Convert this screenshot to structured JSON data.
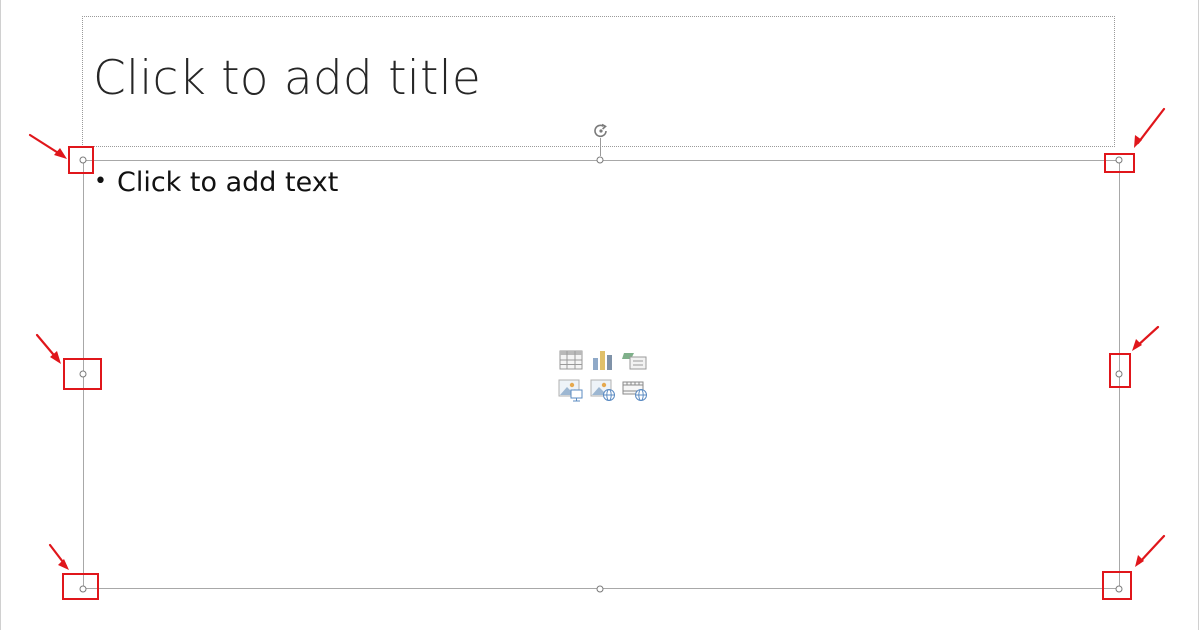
{
  "slide": {
    "title_placeholder": "Click to add title",
    "content_placeholder": {
      "bullet": "•",
      "text": "Click to add text"
    }
  },
  "content_insert_icons": [
    "insert-table-icon",
    "insert-chart-icon",
    "insert-smartart-icon",
    "insert-picture-icon",
    "insert-online-picture-icon",
    "insert-video-icon"
  ],
  "annotation_color": "#e0161b",
  "selection_handles": [
    "top-left",
    "top-center",
    "top-right",
    "middle-left",
    "middle-right",
    "bottom-left",
    "bottom-center",
    "bottom-right"
  ],
  "highlighted_handles": [
    "top-left",
    "top-right",
    "middle-left",
    "middle-right",
    "bottom-left",
    "bottom-right"
  ]
}
